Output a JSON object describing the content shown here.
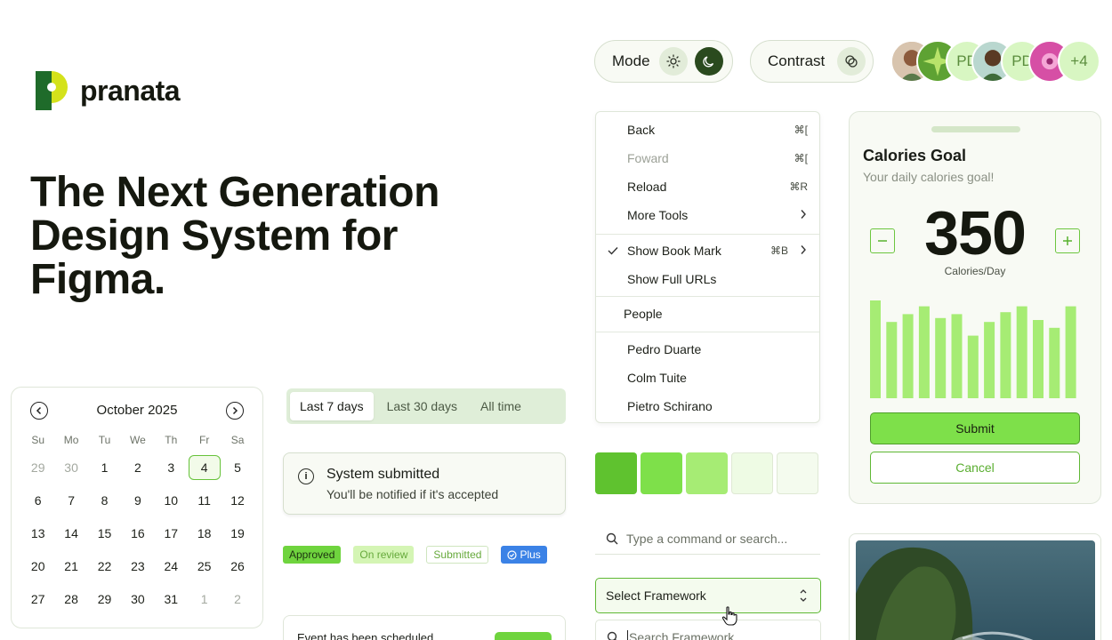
{
  "brand": {
    "name": "pranata"
  },
  "hero": {
    "line1": "The Next Generation",
    "line2": "Design System for",
    "line3": "Figma."
  },
  "calendar": {
    "title": "October 2025",
    "weekdays": [
      "Su",
      "Mo",
      "Tu",
      "We",
      "Th",
      "Fr",
      "Sa"
    ],
    "selected_day": "4",
    "weeks": [
      [
        "29",
        "30",
        "1",
        "2",
        "3",
        "4",
        "5"
      ],
      [
        "6",
        "7",
        "8",
        "9",
        "10",
        "11",
        "12"
      ],
      [
        "13",
        "14",
        "15",
        "16",
        "17",
        "18",
        "19"
      ],
      [
        "20",
        "21",
        "22",
        "23",
        "24",
        "25",
        "26"
      ],
      [
        "27",
        "28",
        "29",
        "30",
        "31",
        "1",
        "2"
      ]
    ]
  },
  "segmented": {
    "options": [
      "Last 7 days",
      "Last 30 days",
      "All time"
    ],
    "active": "Last 7 days"
  },
  "toast": {
    "title": "System submitted",
    "description": "You'll be notified if it's accepted"
  },
  "badges": [
    "Approved",
    "On review",
    "Submitted",
    "Plus"
  ],
  "event": {
    "text": "Event has been scheduled"
  },
  "mode": {
    "label": "Mode"
  },
  "contrast": {
    "label": "Contrast"
  },
  "avatars": {
    "initials": "PD",
    "more": "+4"
  },
  "menu": {
    "items": [
      {
        "label": "Back",
        "shortcut": "⌘["
      },
      {
        "label": "Foward",
        "shortcut": "⌘["
      },
      {
        "label": "Reload",
        "shortcut": "⌘R"
      },
      {
        "label": "More Tools"
      },
      {
        "label": "Show Book Mark",
        "shortcut": "⌘B"
      },
      {
        "label": "Show Full URLs"
      }
    ],
    "section_label": "People",
    "people": [
      "Pedro Duarte",
      "Colm Tuite",
      "Pietro Schirano"
    ]
  },
  "swatches": [
    "#5fc22f",
    "#7ee04a",
    "#a6ec74",
    "#eefbe4",
    "#f4fbee"
  ],
  "command": {
    "placeholder": "Type a command or search..."
  },
  "select": {
    "value": "Select Framework",
    "search_placeholder": "Search Framework...."
  },
  "calories": {
    "title": "Calories Goal",
    "subtitle": "Your daily calories goal!",
    "value": "350",
    "unit": "Calories/Day",
    "submit": "Submit",
    "cancel": "Cancel",
    "bar_values": [
      100,
      78,
      86,
      94,
      82,
      86,
      64,
      78,
      88,
      94,
      80,
      72,
      94
    ],
    "bar_color": "#a6ec74"
  },
  "colors": {
    "accent": "#7ee04a",
    "accent_dark": "#2a4a1e",
    "border": "#dfe6d9"
  }
}
